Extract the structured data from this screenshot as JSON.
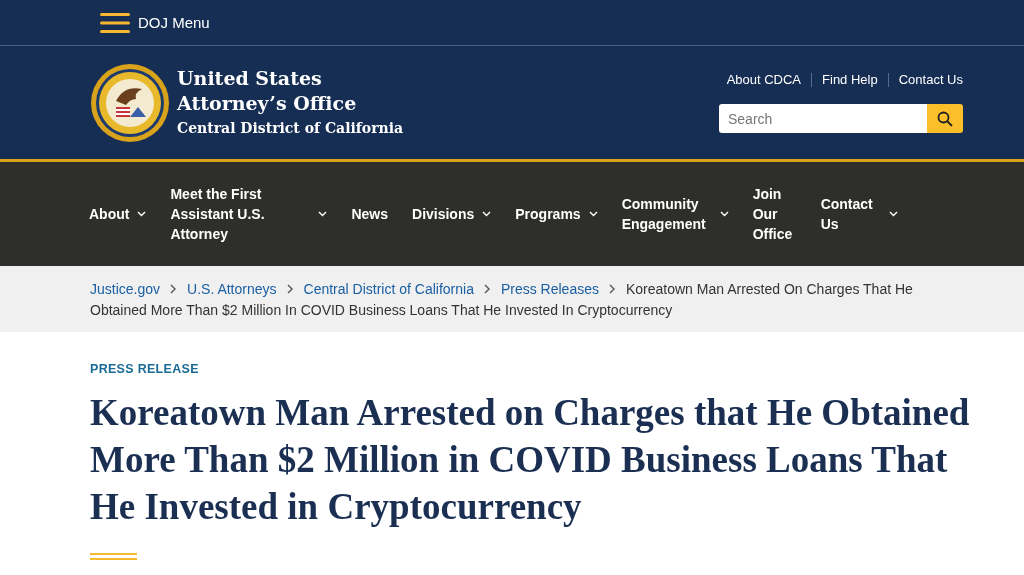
{
  "top_bar": {
    "menu_label": "DOJ Menu"
  },
  "header": {
    "title_line_1": "United States",
    "title_line_2": "Attorney’s Office",
    "subtitle": "Central District of California",
    "utility_links": [
      "About CDCA",
      "Find Help",
      "Contact Us"
    ],
    "search": {
      "placeholder": "Search"
    }
  },
  "nav": [
    {
      "label": "About",
      "kind": "dropdown"
    },
    {
      "label": "Meet the First Assistant U.S. Attorney",
      "kind": "dropdown"
    },
    {
      "label": "News",
      "kind": "link"
    },
    {
      "label": "Divisions",
      "kind": "dropdown"
    },
    {
      "label": "Programs",
      "kind": "dropdown"
    },
    {
      "label": "Community Engagement",
      "kind": "dropdown"
    },
    {
      "label": "Join Our Office",
      "kind": "link"
    },
    {
      "label": "Contact Us",
      "kind": "dropdown"
    }
  ],
  "breadcrumb": {
    "links": [
      "Justice.gov",
      "U.S. Attorneys",
      "Central District of California",
      "Press Releases"
    ],
    "current_lines": [
      "Koreatown Man Arrested On Charges That He",
      "Obtained More Than $2 Million In COVID Business Loans That He Invested In Cryptocurrency"
    ]
  },
  "article": {
    "eyebrow": "PRESS RELEASE",
    "title": "Koreatown Man Arrested on Charges that He Obtained More Than $2 Million in COVID Business Loans That He Invested in Cryptocurrency"
  }
}
